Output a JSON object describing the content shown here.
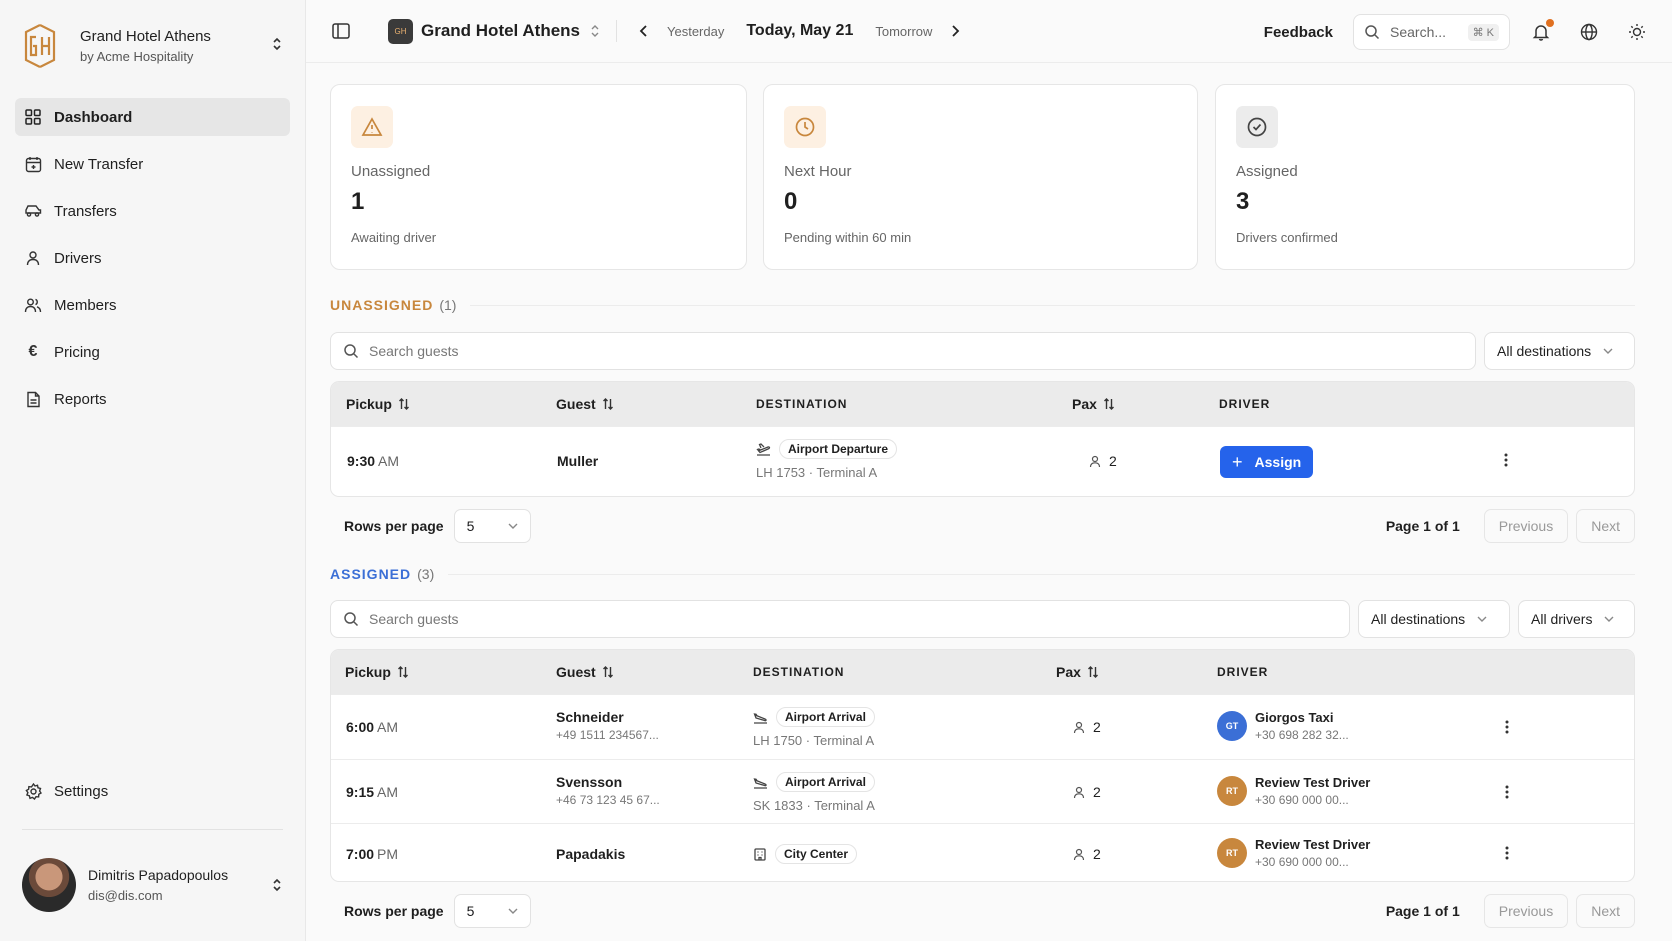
{
  "brand": {
    "name": "Grand Hotel Athens",
    "sub": "by Acme Hospitality",
    "accent": "#c8873d"
  },
  "nav": [
    {
      "label": "Dashboard",
      "icon": "grid-icon",
      "active": true
    },
    {
      "label": "New Transfer",
      "icon": "calendar-plus-icon"
    },
    {
      "label": "Transfers",
      "icon": "car-icon"
    },
    {
      "label": "Drivers",
      "icon": "user-icon"
    },
    {
      "label": "Members",
      "icon": "users-icon"
    },
    {
      "label": "Pricing",
      "icon": "euro-icon"
    },
    {
      "label": "Reports",
      "icon": "document-icon"
    }
  ],
  "settings_label": "Settings",
  "user": {
    "name": "Dimitris Papadopoulos",
    "email": "dis@dis.com"
  },
  "topbar": {
    "hotel_badge": "GH",
    "hotel_name": "Grand Hotel Athens",
    "yesterday": "Yesterday",
    "today": "Today, May 21",
    "tomorrow": "Tomorrow",
    "feedback": "Feedback",
    "search_placeholder": "Search...",
    "search_kbd": "⌘ K"
  },
  "stats": [
    {
      "label": "Unassigned",
      "value": "1",
      "sub": "Awaiting driver",
      "icon": "warning-icon",
      "color": "#c8873d",
      "bg": "#fdf0e2"
    },
    {
      "label": "Next Hour",
      "value": "0",
      "sub": "Pending within 60 min",
      "icon": "clock-icon",
      "color": "#c8873d",
      "bg": "#fdf0e2"
    },
    {
      "label": "Assigned",
      "value": "3",
      "sub": "Drivers confirmed",
      "icon": "check-circle-icon",
      "color": "#444444",
      "bg": "#ececec"
    }
  ],
  "unassigned": {
    "title": "UNASSIGNED",
    "count": "(1)",
    "color": "#c8873d",
    "search_placeholder": "Search guests",
    "dest_filter": "All destinations",
    "columns": {
      "pickup": "Pickup",
      "guest": "Guest",
      "destination": "DESTINATION",
      "pax": "Pax",
      "driver": "DRIVER"
    },
    "rows": [
      {
        "time": "9:30",
        "ampm": "AM",
        "guest": "Muller",
        "phone": "",
        "dest": "Airport Departure",
        "dest_sub": "LH 1753 · Terminal A",
        "pax": "2",
        "action": "Assign"
      }
    ],
    "rows_per_page_label": "Rows per page",
    "rows_per_page": "5",
    "page_info": "Page 1 of 1",
    "prev": "Previous",
    "next": "Next"
  },
  "assigned": {
    "title": "ASSIGNED",
    "count": "(3)",
    "color": "#3b6fd6",
    "search_placeholder": "Search guests",
    "dest_filter": "All destinations",
    "driver_filter": "All drivers",
    "columns": {
      "pickup": "Pickup",
      "guest": "Guest",
      "destination": "DESTINATION",
      "pax": "Pax",
      "driver": "DRIVER"
    },
    "rows": [
      {
        "time": "6:00",
        "ampm": "AM",
        "guest": "Schneider",
        "phone": "+49 1511 234567...",
        "dest": "Airport Arrival",
        "dest_sub": "LH 1750 · Terminal A",
        "dest_icon": "plane-arrival-icon",
        "pax": "2",
        "driver_initials": "GT",
        "driver_color": "#3b6fd6",
        "driver": "Giorgos Taxi",
        "driver_phone": "+30 698 282 32..."
      },
      {
        "time": "9:15",
        "ampm": "AM",
        "guest": "Svensson",
        "phone": "+46 73 123 45 67...",
        "dest": "Airport Arrival",
        "dest_sub": "SK 1833 · Terminal A",
        "dest_icon": "plane-arrival-icon",
        "pax": "2",
        "driver_initials": "RT",
        "driver_color": "#c8873d",
        "driver": "Review Test Driver",
        "driver_phone": "+30 690 000 00..."
      },
      {
        "time": "7:00",
        "ampm": "PM",
        "guest": "Papadakis",
        "phone": "",
        "dest": "City Center",
        "dest_sub": "",
        "dest_icon": "building-icon",
        "pax": "2",
        "driver_initials": "RT",
        "driver_color": "#c8873d",
        "driver": "Review Test Driver",
        "driver_phone": "+30 690 000 00..."
      }
    ],
    "rows_per_page_label": "Rows per page",
    "rows_per_page": "5",
    "page_info": "Page 1 of 1",
    "prev": "Previous",
    "next": "Next"
  }
}
